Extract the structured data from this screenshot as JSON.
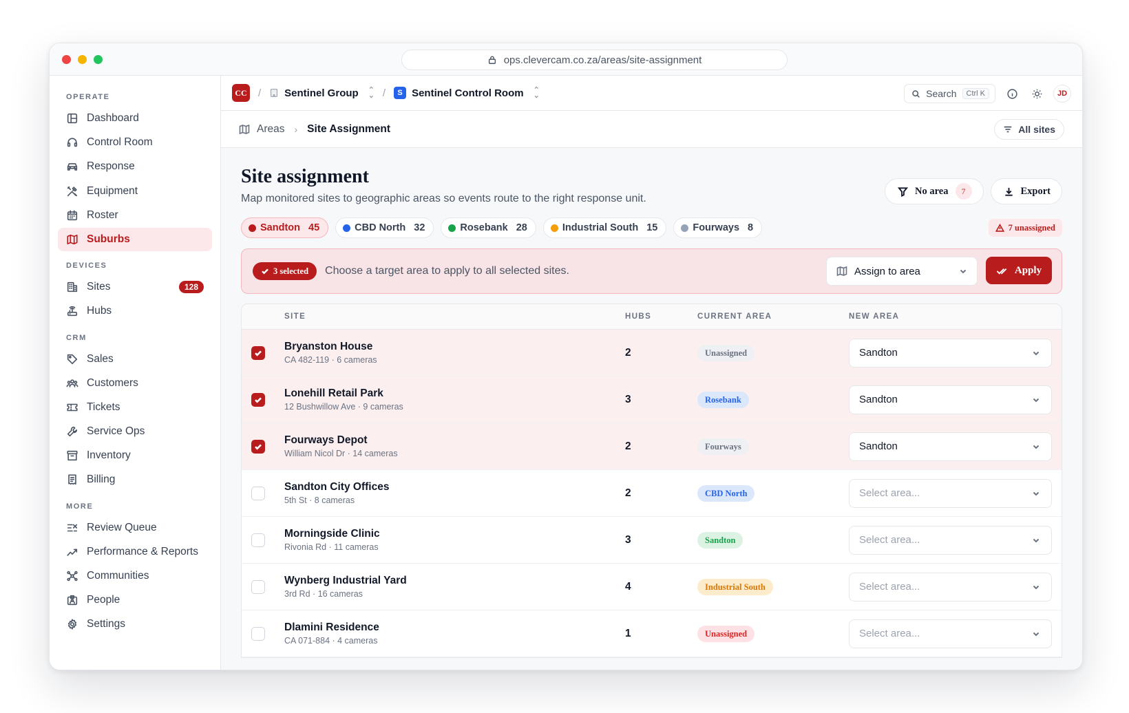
{
  "browser": {
    "url": "ops.clevercam.co.za/areas/site-assignment"
  },
  "sidebar": {
    "sections": [
      {
        "label": "OPERATE",
        "items": [
          {
            "label": "Dashboard",
            "icon": "dashboard-icon"
          },
          {
            "label": "Control Room",
            "icon": "headset-icon"
          },
          {
            "label": "Response",
            "icon": "car-icon"
          },
          {
            "label": "Equipment",
            "icon": "tools-icon"
          },
          {
            "label": "Roster",
            "icon": "calendar-icon"
          },
          {
            "label": "Suburbs",
            "icon": "map-icon",
            "active": true
          }
        ]
      },
      {
        "label": "DEVICES",
        "items": [
          {
            "label": "Sites",
            "icon": "building-icon",
            "badge": "128"
          },
          {
            "label": "Hubs",
            "icon": "router-icon"
          }
        ]
      },
      {
        "label": "CRM",
        "items": [
          {
            "label": "Sales",
            "icon": "tag-icon"
          },
          {
            "label": "Customers",
            "icon": "users-icon"
          },
          {
            "label": "Tickets",
            "icon": "ticket-icon"
          },
          {
            "label": "Service Ops",
            "icon": "wrench-icon"
          },
          {
            "label": "Inventory",
            "icon": "archive-icon"
          },
          {
            "label": "Billing",
            "icon": "receipt-icon"
          }
        ]
      },
      {
        "label": "MORE",
        "items": [
          {
            "label": "Review Queue",
            "icon": "list-check-icon"
          },
          {
            "label": "Performance & Reports",
            "icon": "trend-icon"
          },
          {
            "label": "Communities",
            "icon": "network-icon"
          },
          {
            "label": "People",
            "icon": "id-card-icon"
          },
          {
            "label": "Settings",
            "icon": "gear-icon"
          }
        ]
      }
    ]
  },
  "topbar": {
    "logo": "CC",
    "org": "Sentinel Group",
    "room_badge": "S",
    "room": "Sentinel Control Room",
    "search_label": "Search",
    "search_shortcut": "Ctrl K",
    "avatar": "JD"
  },
  "breadcrumb": {
    "parent": "Areas",
    "current": "Site Assignment",
    "filter_label": "All sites"
  },
  "page": {
    "title": "Site assignment",
    "subtitle": "Map monitored sites to geographic areas so events route to the right response unit.",
    "no_area_label": "No area",
    "no_area_count": "7",
    "export_label": "Export",
    "unassigned_label": "7 unassigned"
  },
  "area_chips": [
    {
      "name": "Sandton",
      "count": "45",
      "color": "#b91c1c",
      "active": true
    },
    {
      "name": "CBD North",
      "count": "32",
      "color": "#2563eb"
    },
    {
      "name": "Rosebank",
      "count": "28",
      "color": "#16a34a"
    },
    {
      "name": "Industrial South",
      "count": "15",
      "color": "#f59e0b"
    },
    {
      "name": "Fourways",
      "count": "8",
      "color": "#94a3b8"
    }
  ],
  "selection_bar": {
    "selected_label": "3 selected",
    "instruction": "Choose a target area to apply to all selected sites.",
    "dropdown_label": "Assign to area",
    "apply_label": "Apply"
  },
  "table": {
    "headers": {
      "site": "SITE",
      "hubs": "HUBS",
      "current": "CURRENT AREA",
      "new": "NEW AREA"
    },
    "rows": [
      {
        "name": "Bryanston House",
        "meta": "CA 482-119 · 6 cameras",
        "hubs": "2",
        "current": "Unassigned",
        "current_style": "gray",
        "new": "Sandton",
        "selected": true
      },
      {
        "name": "Lonehill Retail Park",
        "meta": "12 Bushwillow Ave · 9 cameras",
        "hubs": "3",
        "current": "Rosebank",
        "current_style": "blue",
        "new": "Sandton",
        "selected": true
      },
      {
        "name": "Fourways Depot",
        "meta": "William Nicol Dr · 14 cameras",
        "hubs": "2",
        "current": "Fourways",
        "current_style": "gray",
        "new": "Sandton",
        "selected": true
      },
      {
        "name": "Sandton City Offices",
        "meta": "5th St · 8 cameras",
        "hubs": "2",
        "current": "CBD North",
        "current_style": "blue",
        "new": "",
        "selected": false
      },
      {
        "name": "Morningside Clinic",
        "meta": "Rivonia Rd · 11 cameras",
        "hubs": "3",
        "current": "Sandton",
        "current_style": "green",
        "new": "",
        "selected": false
      },
      {
        "name": "Wynberg Industrial Yard",
        "meta": "3rd Rd · 16 cameras",
        "hubs": "4",
        "current": "Industrial South",
        "current_style": "amber",
        "new": "",
        "selected": false
      },
      {
        "name": "Dlamini Residence",
        "meta": "CA 071-884 · 4 cameras",
        "hubs": "1",
        "current": "Unassigned",
        "current_style": "red",
        "new": "",
        "selected": false
      }
    ],
    "placeholder": "Select area..."
  },
  "colors": {
    "brand": "#b91c1c",
    "badge_gray_bg": "#eef0f3",
    "badge_gray_fg": "#6b7280",
    "badge_blue_bg": "#dbe7fb",
    "badge_blue_fg": "#2563eb",
    "badge_green_bg": "#dcf3e4",
    "badge_green_fg": "#16a34a",
    "badge_amber_bg": "#fdeccc",
    "badge_amber_fg": "#d97706",
    "badge_red_bg": "#fde1e4",
    "badge_red_fg": "#dc2626"
  }
}
